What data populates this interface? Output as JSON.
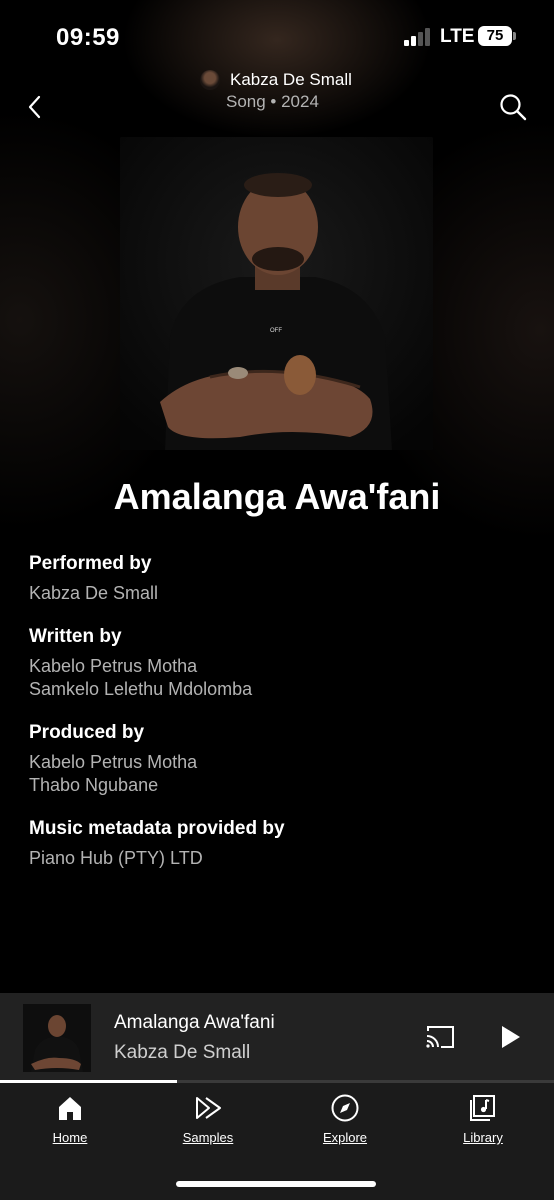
{
  "status_bar": {
    "time": "09:59",
    "network": "LTE",
    "battery": "75"
  },
  "header": {
    "artist": "Kabza De Small",
    "subtitle": "Song • 2024"
  },
  "song": {
    "title": "Amalanga Awa'fani"
  },
  "credits": [
    {
      "heading": "Performed by",
      "names": [
        "Kabza De Small"
      ]
    },
    {
      "heading": "Written by",
      "names": [
        "Kabelo Petrus Motha",
        "Samkelo Lelethu Mdolomba"
      ]
    },
    {
      "heading": "Produced by",
      "names": [
        "Kabelo Petrus Motha",
        "Thabo Ngubane"
      ]
    },
    {
      "heading": "Music metadata provided by",
      "names": [
        "Piano Hub (PTY) LTD"
      ]
    }
  ],
  "mini_player": {
    "title": "Amalanga Awa'fani",
    "artist": "Kabza De Small",
    "progress": 0.32
  },
  "nav": [
    {
      "label": "Home",
      "icon": "home-icon"
    },
    {
      "label": "Samples",
      "icon": "samples-icon"
    },
    {
      "label": "Explore",
      "icon": "compass-icon"
    },
    {
      "label": "Library",
      "icon": "library-icon"
    }
  ],
  "colors": {
    "background": "#000000",
    "secondary_text": "#b3b3b3",
    "mini_player_bg": "#222222",
    "nav_bg": "#1b1b1b"
  }
}
